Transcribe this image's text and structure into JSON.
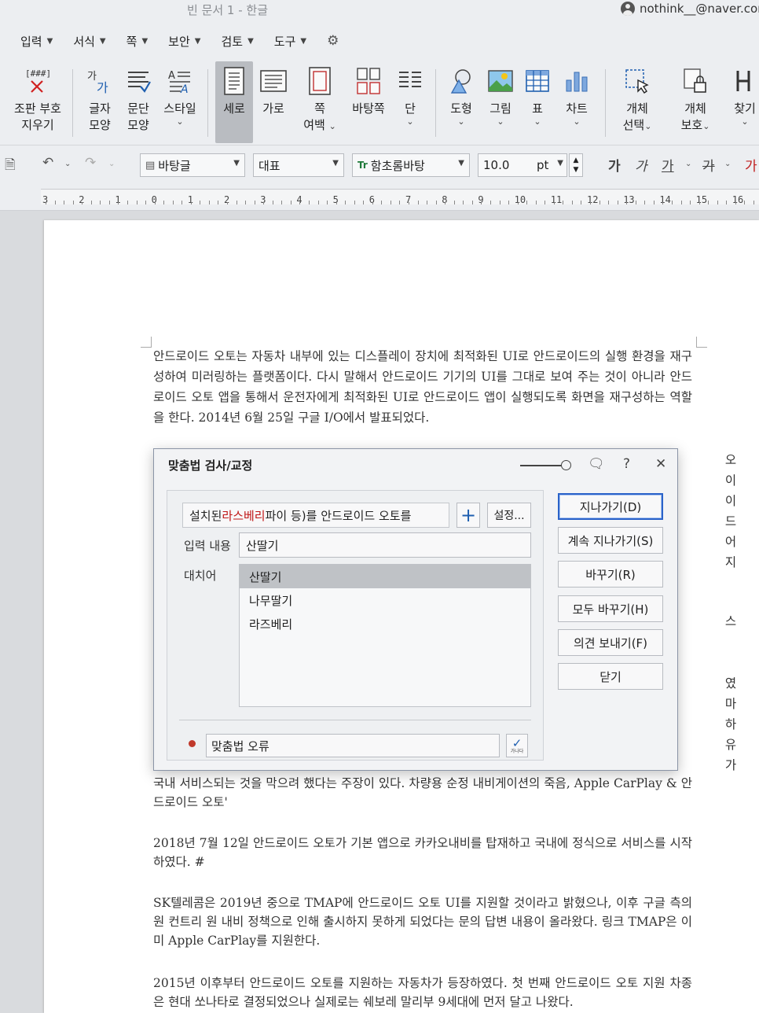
{
  "window": {
    "doc_title": "빈 문서 1 - 한글",
    "account": "nothink__@naver.com"
  },
  "menu": [
    {
      "label": "입력"
    },
    {
      "label": "서식"
    },
    {
      "label": "쪽"
    },
    {
      "label": "보안"
    },
    {
      "label": "검토"
    },
    {
      "label": "도구"
    }
  ],
  "ribbon": {
    "mark_remove": {
      "icon_text": "[###]",
      "line1": "조판 부호",
      "line2": "지우기"
    },
    "char_shape": {
      "icon_text": "가가",
      "line1": "글자",
      "line2": "모양"
    },
    "para_shape": {
      "line1": "문단",
      "line2": "모양"
    },
    "style": {
      "line1": "스타일"
    },
    "portrait": {
      "line1": "세로"
    },
    "landscape": {
      "line1": "가로"
    },
    "margin": {
      "line1": "쪽",
      "line2": "여백"
    },
    "master": {
      "line1": "바탕쪽"
    },
    "columns": {
      "line1": "단"
    },
    "shape": {
      "line1": "도형"
    },
    "picture": {
      "line1": "그림"
    },
    "table": {
      "line1": "표"
    },
    "chart": {
      "line1": "차트"
    },
    "obj_select": {
      "line1": "개체",
      "line2": "선택"
    },
    "obj_protect": {
      "line1": "개체",
      "line2": "보호"
    },
    "find": {
      "line1": "찾기"
    }
  },
  "format_bar": {
    "style_name": "바탕글",
    "lang": "대표",
    "font": "함초롬바탕",
    "font_badge": "Tr",
    "size": "10.0",
    "unit": "pt",
    "bold": "가",
    "italic": "가",
    "underline": "가",
    "strike": "가"
  },
  "ruler": {
    "numbers": [
      "3",
      "2",
      "1",
      "0",
      "1",
      "2",
      "3",
      "4",
      "5",
      "6",
      "7",
      "8",
      "9",
      "10",
      "11",
      "12",
      "13",
      "14",
      "15",
      "16"
    ]
  },
  "document": {
    "p1": "안드로이드 오토는 자동차 내부에 있는 디스플레이 장치에 최적화된 UI로 안드로이드의 실행 환경을 재구성하여 미러링하는 플랫폼이다. 다시 말해서 안드로이드 기기의 UI를 그대로 보여 주는 것이 아니라 안드로이드 오토 앱을 통해서 운전자에게 최적화된 UI로 안드로이드 앱이 실행되도록 화면을 재구성하는 역할을 한다. 2014년 6월 25일 구글 I/O에서 발표되었다.",
    "p2_partial": "국내 서비스되는 것을 막으려 했다는 주장이 있다. 차량용 순정 내비게이션의 죽음, Apple CarPlay & 안드로이드 오토'",
    "p3": "2018년 7월 12일 안드로이드 오토가 기본 앱으로 카카오내비를 탑재하고 국내에 정식으로 서비스를 시작하였다. #",
    "p4": "SK텔레콤은 2019년 중으로 TMAP에 안드로이드 오토 UI를 지원할 것이라고 밝혔으나, 이후 구글 측의 원 컨트리 원 내비 정책으로 인해 출시하지 못하게 되었다는 문의 답변 내용이 올라왔다. 링크 TMAP은 이미 Apple CarPlay를 지원한다.",
    "p5": "2015년 이후부터 안드로이드 오토를 지원하는 자동차가 등장하였다. 첫 번째 안드로이드 오토 지원 차종은 현대 쏘나타로 결정되었으나 실제로는 쉐보레 말리부 9세대에 먼저 달고 나왔다.",
    "side_chars_a": [
      "오",
      "이",
      "이",
      "드",
      "어",
      "지"
    ],
    "side_chars_b": [
      "스"
    ],
    "side_chars_c": [
      "였",
      "마",
      "하",
      "유",
      "가"
    ]
  },
  "dialog": {
    "title": "맞춤법 검사/교정",
    "help": "?",
    "close": "✕",
    "sentence_pre": "설치된 ",
    "sentence_err": "라스베리",
    "sentence_post": " 파이 등)를 안드로이드 오토를",
    "plus": "+",
    "settings": "설정...",
    "input_label": "입력 내용",
    "input_value": "산딸기",
    "replace_label": "대치어",
    "suggestions": [
      "산딸기",
      "나무딸기",
      "라즈베리"
    ],
    "error_type": "맞춤법 오류",
    "check_tiny": "가나다",
    "buttons": {
      "skip": "지나가기(D)",
      "skip_all": "계속 지나가기(S)",
      "replace": "바꾸기(R)",
      "replace_all": "모두 바꾸기(H)",
      "feedback": "의견 보내기(F)",
      "close": "닫기"
    }
  }
}
